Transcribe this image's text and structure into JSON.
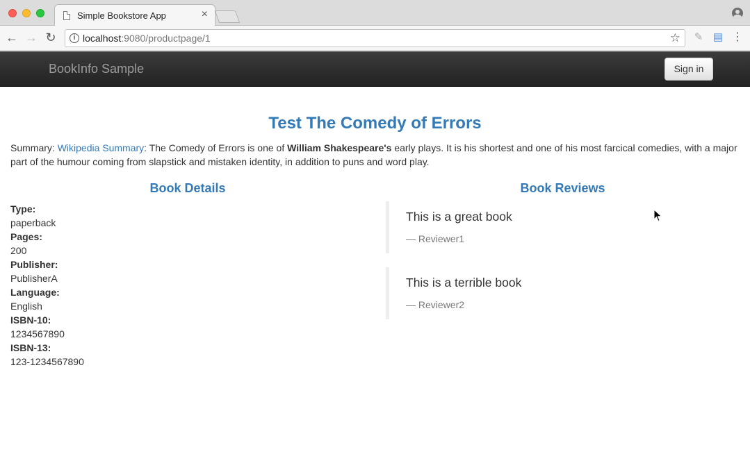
{
  "browser": {
    "tab_title": "Simple Bookstore App",
    "tab_close": "×",
    "url_host": "localhost",
    "url_rest": ":9080/productpage/1"
  },
  "navbar": {
    "brand": "BookInfo Sample",
    "signin_label": "Sign in"
  },
  "book": {
    "title": "Test The Comedy of Errors",
    "summary_label": "Summary: ",
    "summary_link": "Wikipedia Summary",
    "summary_before_bold": ": The Comedy of Errors is one of ",
    "summary_bold": "William Shakespeare's",
    "summary_after_bold": " early plays. It is his shortest and one of his most farcical comedies, with a major part of the humour coming from slapstick and mistaken identity, in addition to puns and word play."
  },
  "details": {
    "heading": "Book Details",
    "items": [
      {
        "label": "Type:",
        "value": "paperback"
      },
      {
        "label": "Pages:",
        "value": "200"
      },
      {
        "label": "Publisher:",
        "value": "PublisherA"
      },
      {
        "label": "Language:",
        "value": "English"
      },
      {
        "label": "ISBN-10:",
        "value": "1234567890"
      },
      {
        "label": "ISBN-13:",
        "value": "123-1234567890"
      }
    ]
  },
  "reviews": {
    "heading": "Book Reviews",
    "items": [
      {
        "text": "This is a great book",
        "author": "— Reviewer1"
      },
      {
        "text": "This is a terrible book",
        "author": "— Reviewer2"
      }
    ]
  },
  "colors": {
    "accent": "#337ab7",
    "navbar": "#222222"
  }
}
